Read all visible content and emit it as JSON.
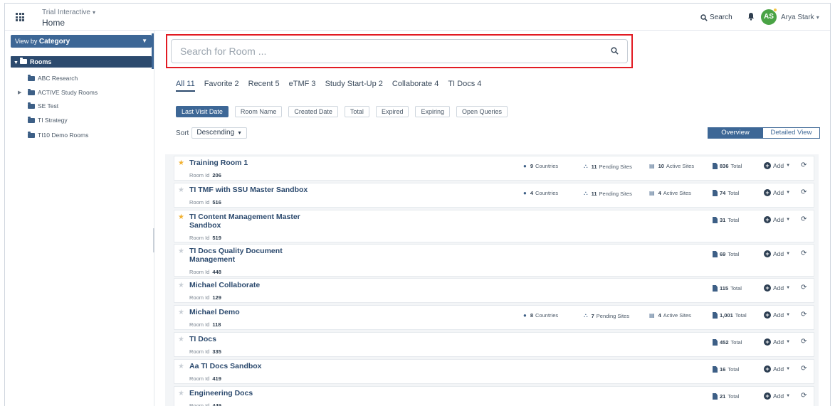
{
  "header": {
    "app_name": "Trial Interactive",
    "page": "Home",
    "search_label": "Search",
    "user_initials": "AS",
    "user_name": "Arya Stark"
  },
  "sidebar": {
    "view_by_prefix": "View by",
    "view_by_value": "Category",
    "root": "Rooms",
    "items": [
      {
        "label": "ABC Research",
        "expandable": false
      },
      {
        "label": "ACTIVE Study Rooms",
        "expandable": true
      },
      {
        "label": "SE Test",
        "expandable": false
      },
      {
        "label": "TI Strategy",
        "expandable": false
      },
      {
        "label": "TI10 Demo Rooms",
        "expandable": false
      }
    ]
  },
  "search": {
    "placeholder": "Search for Room ..."
  },
  "tabs": [
    "All 11",
    "Favorite 2",
    "Recent 5",
    "eTMF 3",
    "Study Start-Up 2",
    "Collaborate 4",
    "TI Docs 4"
  ],
  "sort_buttons": [
    "Last Visit Date",
    "Room Name",
    "Created Date",
    "Total",
    "Expired",
    "Expiring",
    "Open Queries"
  ],
  "sort": {
    "label": "Sort",
    "value": "Descending"
  },
  "view_toggle": {
    "overview": "Overview",
    "detailed": "Detailed View"
  },
  "room_id_label": "Room Id",
  "add_label": "Add",
  "rooms": [
    {
      "title": "Training Room 1",
      "id": "206",
      "favorite": true,
      "countries": "9",
      "pending": "11",
      "active": "10",
      "total": "836"
    },
    {
      "title": "TI TMF with SSU Master Sandbox",
      "id": "516",
      "favorite": false,
      "countries": "4",
      "pending": "11",
      "active": "4",
      "total": "74"
    },
    {
      "title": "TI Content Management Master Sandbox",
      "id": "519",
      "favorite": true,
      "total": "31"
    },
    {
      "title": "TI Docs Quality Document Management",
      "id": "448",
      "favorite": false,
      "total": "69"
    },
    {
      "title": "Michael Collaborate",
      "id": "129",
      "favorite": false,
      "total": "115"
    },
    {
      "title": "Michael Demo",
      "id": "118",
      "favorite": false,
      "countries": "8",
      "pending": "7",
      "active": "4",
      "total": "1,001"
    },
    {
      "title": "TI Docs",
      "id": "335",
      "favorite": false,
      "total": "452"
    },
    {
      "title": "Aa TI Docs Sandbox",
      "id": "419",
      "favorite": false,
      "total": "16"
    },
    {
      "title": "Engineering Docs",
      "id": "449",
      "favorite": false,
      "total": "21"
    }
  ],
  "stat_labels": {
    "countries": "Countries",
    "pending": "Pending Sites",
    "active": "Active Sites",
    "total": "Total"
  },
  "colors": {
    "primary": "#2c4a6e",
    "accent": "#3d6796",
    "highlight": "#e21b23",
    "favorite": "#f2b233",
    "avatar": "#4aa345"
  }
}
